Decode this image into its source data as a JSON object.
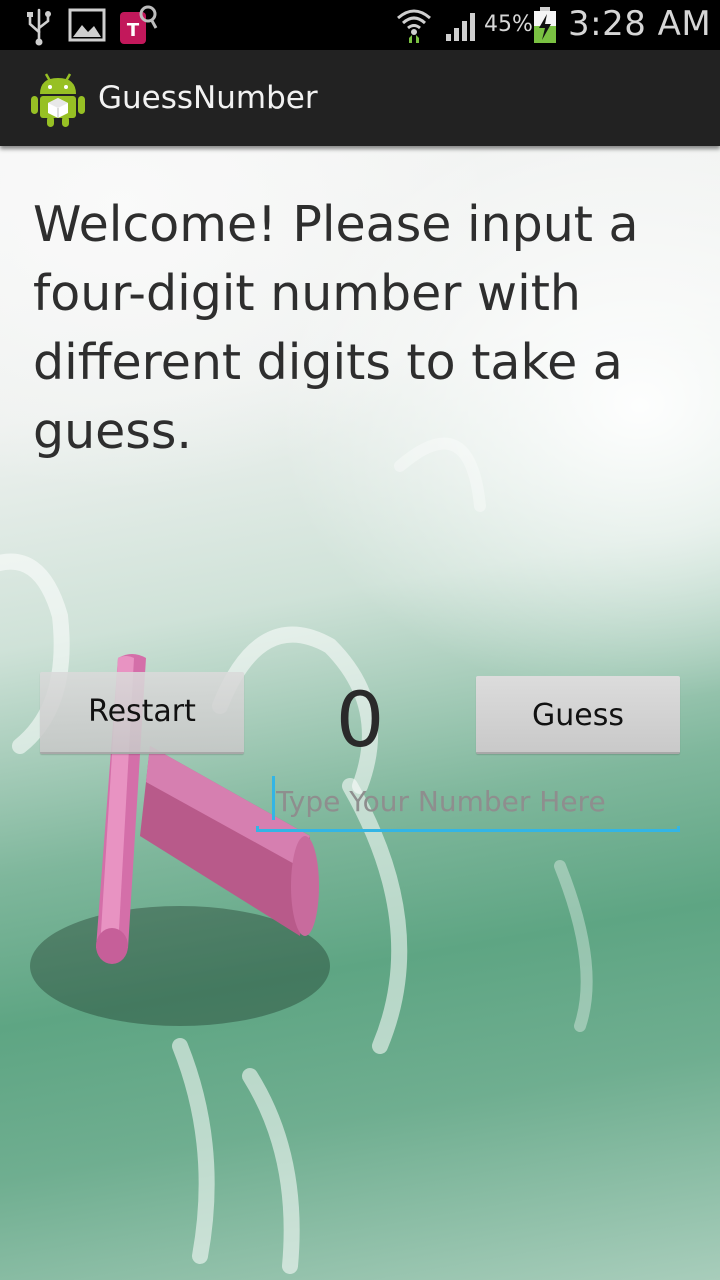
{
  "status_bar": {
    "battery_percent": "45%",
    "time": "3:28 AM",
    "icons": [
      "usb-icon",
      "gallery-icon",
      "tmobile-icon",
      "wifi-icon",
      "signal-icon",
      "battery-charging-icon"
    ]
  },
  "action_bar": {
    "title": "GuessNumber",
    "icon": "android-app-icon"
  },
  "main": {
    "welcome_text": "Welcome! Please input a four-digit number with different digits to take a guess.",
    "restart_label": "Restart",
    "counter_value": "0",
    "guess_label": "Guess",
    "input": {
      "value": "",
      "placeholder": "Type Your Number Here"
    }
  },
  "colors": {
    "accent": "#33b5e5",
    "action_bar": "#222222",
    "status_bar": "#000000"
  }
}
